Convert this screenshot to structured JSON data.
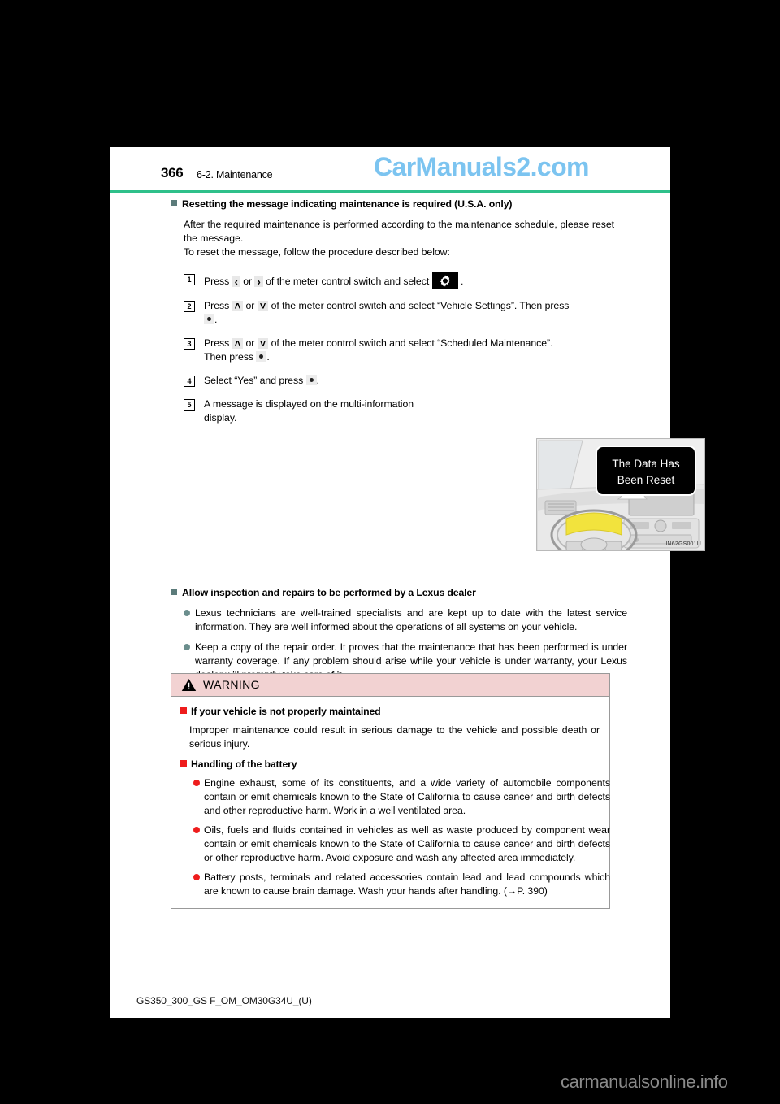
{
  "watermarks": {
    "top": "CarManuals2.com",
    "top_color": "#7cc4f0",
    "bottom": "carmanualsonline.info",
    "bottom_color": "#8a8a8a"
  },
  "header": {
    "page_number": "366",
    "section": "6-2. Maintenance",
    "rule_color": "#2fc08a"
  },
  "reset_section": {
    "heading": "Resetting the message indicating maintenance is required (U.S.A. only)",
    "intro_1": "After the required maintenance is performed according to the maintenance schedule, please reset the message.",
    "intro_2": "To reset the message, follow the procedure described below:",
    "steps": [
      {
        "num": "1",
        "part_a": "Press",
        "key_left": "‹",
        "or": "or",
        "key_right": "›",
        "part_b": "of the meter control switch and select",
        "icon": "gear-icon",
        "part_c": "."
      },
      {
        "num": "2",
        "part_a": "Press",
        "key_up": "˄",
        "or": "or",
        "key_down": "˅",
        "part_b": "of the meter control switch and select “Vehicle Settings”. Then press",
        "button": "enter-dot-button",
        "part_c": "."
      },
      {
        "num": "3",
        "part_a": "Press",
        "key_up": "˄",
        "or": "or",
        "key_down": "˅",
        "part_b": "of the meter control switch and select “Scheduled Maintenance”.",
        "part_b2": "Then press",
        "button": "enter-dot-button",
        "part_c": "."
      },
      {
        "num": "4",
        "part_a": "Select “Yes” and press",
        "button": "enter-dot-button",
        "part_c": "."
      },
      {
        "num": "5",
        "part_a": "A message is displayed on the multi-information display."
      }
    ],
    "figure": {
      "callout_line_1": "The Data Has",
      "callout_line_2": "Been Reset",
      "code": "IN62GS001U",
      "alt": "dashboard-with-multi-information-display-message"
    }
  },
  "dealer_section": {
    "heading": "Allow inspection and repairs to be performed by a Lexus dealer",
    "bullets": [
      "Lexus technicians are well-trained specialists and are kept up to date with the latest service information. They are well informed about the operations of all systems on your vehicle.",
      "Keep a copy of the repair order. It proves that the maintenance that has been performed is under warranty coverage. If any problem should arise while your vehicle is under warranty, your Lexus dealer will promptly take care of it."
    ]
  },
  "warning": {
    "title": "WARNING",
    "head_bg": "#f2d2d2",
    "marker_color": "#ee1c1c",
    "groups": [
      {
        "subheading": "If your vehicle is not properly maintained",
        "paragraph": "Improper maintenance could result in serious damage to the vehicle and possible death or serious injury.",
        "bullets": []
      },
      {
        "subheading": "Handling of the battery",
        "paragraph": "",
        "bullets": [
          "Engine exhaust, some of its constituents, and a wide variety of automobile components contain or emit chemicals known to the State of California to cause cancer and birth defects and other reproductive harm. Work in a well ventilated area.",
          "Oils, fuels and fluids contained in vehicles as well as waste produced by component wear contain or emit chemicals known to the State of California to cause cancer and birth defects or other reproductive harm. Avoid exposure and wash any affected area immediately.",
          "Battery posts, terminals and related accessories contain lead and lead compounds which are known to cause brain damage. Wash your hands after handling. (→P. 390)"
        ]
      }
    ]
  },
  "footer": {
    "code": "GS350_300_GS F_OM_OM30G34U_(U)"
  }
}
